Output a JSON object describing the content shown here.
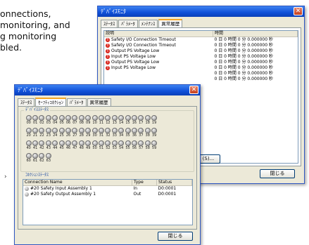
{
  "background_text": [
    "onnections,",
    "monitoring, and",
    "g monitoring",
    "bled."
  ],
  "window_back": {
    "title": "ﾃﾞﾊﾞｲｽﾓﾆﾀ",
    "tabs": [
      "ｽﾃｰﾀｽ",
      "ﾊﾟﾗﾒｰﾀ",
      "ﾒﾝﾃﾅﾝｽ",
      "異常履歴"
    ],
    "columns": [
      "説明",
      "時間"
    ],
    "rows": [
      {
        "desc": "Safety I/O Connection Timeout",
        "time": "0 日 0 時間 0 分 0.000000 秒"
      },
      {
        "desc": "Safety I/O Connection Timeout",
        "time": "0 日 0 時間 0 分 0.000000 秒"
      },
      {
        "desc": "Output PS Voltage Low",
        "time": "0 日 0 時間 0 分 0.000000 秒"
      },
      {
        "desc": "Input PS Voltage Low",
        "time": "0 日 0 時間 0 分 0.000000 秒"
      },
      {
        "desc": "Output PS Voltage Low",
        "time": "0 日 0 時間 0 分 0.000000 秒"
      },
      {
        "desc": "Input PS Voltage Low",
        "time": "0 日 0 時間 0 分 0.000000 秒"
      },
      {
        "desc": "",
        "time": "0 日 0 時間 0 分 0.000000 秒"
      },
      {
        "desc": "",
        "time": "0 日 0 時間 0 分 0.000000 秒"
      }
    ],
    "save_button": "(S)...",
    "close_button": "閉じる"
  },
  "window_front": {
    "title": "ﾃﾞﾊﾞｲｽﾓﾆﾀ",
    "tabs": [
      "ｽﾃｰﾀｽ",
      "ｾｰﾌﾃｨｺﾈｸｼｮﾝ",
      "ﾊﾟﾗﾒｰﾀ",
      "異常履歴"
    ],
    "device_status_label": "ﾃﾞﾊﾞｲｽｽﾃｰﾀｽ",
    "node_rows": [
      [
        "00",
        "01",
        "02",
        "03",
        "04",
        "05",
        "06",
        "07",
        "08",
        "09",
        "10",
        "11",
        "12",
        "13",
        "14",
        "15",
        "16",
        "17",
        "18",
        "19"
      ],
      [
        "20",
        "21",
        "22",
        "23",
        "24",
        "25",
        "26",
        "27",
        "28",
        "29",
        "30",
        "31",
        "32",
        "33",
        "34",
        "35",
        "36",
        "37",
        "38",
        "39"
      ],
      [
        "40",
        "41",
        "42",
        "43",
        "44",
        "45",
        "46",
        "47",
        "48",
        "49",
        "50",
        "51",
        "52",
        "53",
        "54",
        "55",
        "56",
        "57",
        "58",
        "59"
      ],
      [
        "60",
        "61",
        "62",
        "63"
      ]
    ],
    "connection_status_label": "ｺﾈｸｼｮﾝｽﾃｰﾀｽ",
    "connection_columns": [
      "Connection Name",
      "Type",
      "Status"
    ],
    "connections": [
      {
        "name": "#20 Safety Input Assembly 1",
        "type": "In",
        "status": "D0:0001"
      },
      {
        "name": "#20 Safety Output Assembly 1",
        "type": "Out",
        "status": "D0:0001"
      }
    ],
    "close_button": "閉じる"
  }
}
